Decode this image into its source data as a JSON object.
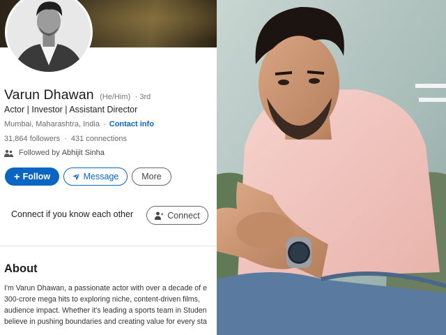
{
  "profile": {
    "name": "Varun Dhawan",
    "pronouns": "(He/Him)",
    "degree": "· 3rd",
    "headline": "Actor | Investor | Assistant Director",
    "location": "Mumbai, Maharashtra, India",
    "location_sep": "·",
    "contact_info": "Contact info",
    "followers": "31,864 followers",
    "stats_sep": "·",
    "connections": "431 connections",
    "followed_by_prefix": "Followed by",
    "followed_by_name": "Abhijit Sinha"
  },
  "actions": {
    "follow_label": "Follow",
    "message_label": "Message",
    "more_label": "More"
  },
  "connect_prompt": {
    "text": "Connect if you know each other",
    "button_label": "Connect"
  },
  "about": {
    "title": "About",
    "lines": [
      "I'm Varun Dhawan, a passionate actor with over a decade of e",
      "300-crore mega hits to exploring niche, content-driven films,",
      "audience impact. Whether it's leading a sports team in Studen",
      "believe in pushing boundaries and creating value for every sta"
    ]
  },
  "icons": {
    "avatar": "profile-photo",
    "followed": "people-icon",
    "message": "send-icon",
    "connect": "add-person-icon"
  },
  "colors": {
    "brand_blue": "#0a66c2",
    "shirt_pink": "#f2c6c0"
  }
}
